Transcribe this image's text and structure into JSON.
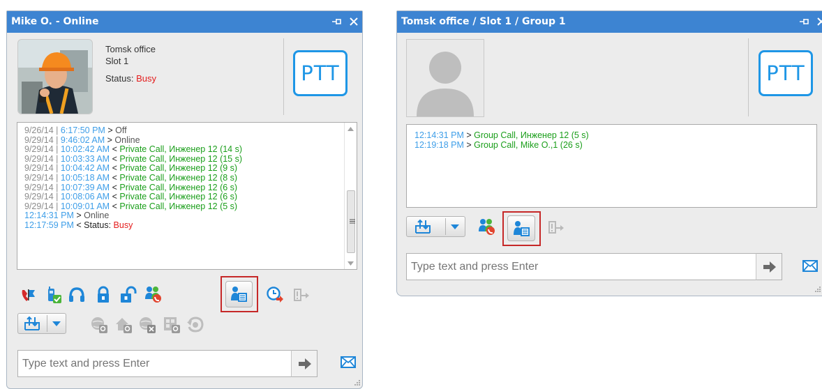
{
  "window1": {
    "title": "Mike O. - Online",
    "office": "Tomsk office",
    "slot": "Slot 1",
    "status_label": "Status:",
    "status_value": "Busy",
    "ptt_label": "PTT",
    "log": [
      {
        "date": "9/26/14 | ",
        "time": "6:17:50 PM",
        "dir": " > ",
        "event": "Off",
        "cls": "gr"
      },
      {
        "date": "9/29/14 | ",
        "time": "9:46:02 AM",
        "dir": " > ",
        "event": "Online",
        "cls": "gr"
      },
      {
        "date": "9/29/14 | ",
        "time": "10:02:42 AM",
        "dir": " < ",
        "event": "Private Call, Инженер 12 (14 s)",
        "cls": "ev"
      },
      {
        "date": "9/29/14 | ",
        "time": "10:03:33 AM",
        "dir": " < ",
        "event": "Private Call, Инженер 12 (15 s)",
        "cls": "ev"
      },
      {
        "date": "9/29/14 | ",
        "time": "10:04:42 AM",
        "dir": " < ",
        "event": "Private Call, Инженер 12 (9 s)",
        "cls": "ev"
      },
      {
        "date": "9/29/14 | ",
        "time": "10:05:18 AM",
        "dir": " < ",
        "event": "Private Call, Инженер 12 (8 s)",
        "cls": "ev"
      },
      {
        "date": "9/29/14 | ",
        "time": "10:07:39 AM",
        "dir": " < ",
        "event": "Private Call, Инженер 12 (6 s)",
        "cls": "ev"
      },
      {
        "date": "9/29/14 | ",
        "time": "10:08:06 AM",
        "dir": " < ",
        "event": "Private Call, Инженер 12 (6 s)",
        "cls": "ev"
      },
      {
        "date": "9/29/14 | ",
        "time": "10:09:01 AM",
        "dir": " < ",
        "event": "Private Call, Инженер 12 (5 s)",
        "cls": "ev"
      },
      {
        "date": "",
        "time": "12:14:31 PM",
        "dir": " > ",
        "event": "Online",
        "cls": "gr"
      }
    ],
    "log_last": {
      "time": "12:17:59 PM",
      "dir": " < ",
      "label": "Status: ",
      "value": "Busy"
    },
    "input_placeholder": "Type text and press Enter"
  },
  "window2": {
    "title": "Tomsk office / Slot 1 / Group 1",
    "ptt_label": "PTT",
    "log": [
      {
        "time": "12:14:31 PM",
        "dir": " > ",
        "event": "Group Call, Инженер 12 (5 s)"
      },
      {
        "time": "12:19:18 PM",
        "dir": " > ",
        "event": "Group Call, Mike O.,1 (26 s)"
      }
    ],
    "input_placeholder": "Type text and press Enter"
  },
  "colors": {
    "titlebar": "#3d84d2",
    "accent_blue": "#1e96e6",
    "event_green": "#1a9e1a",
    "busy_red": "#e41c1c",
    "highlight": "#c62828"
  }
}
